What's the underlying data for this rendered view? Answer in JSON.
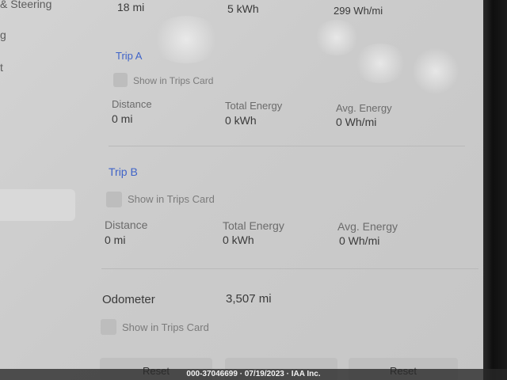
{
  "sidebar": {
    "items": [
      {
        "label": "& Steering"
      },
      {
        "label": "g"
      },
      {
        "label": "t"
      }
    ]
  },
  "top_partial": {
    "distance_value": "18 mi",
    "energy_value": "5 kWh",
    "avg_value": "299 Wh/mi"
  },
  "trip_a": {
    "title": "Trip A",
    "checkbox_label": "Show in Trips Card",
    "distance_label": "Distance",
    "distance_value": "0 mi",
    "energy_label": "Total Energy",
    "energy_value": "0 kWh",
    "avg_label": "Avg. Energy",
    "avg_value": "0 Wh/mi"
  },
  "trip_b": {
    "title": "Trip B",
    "checkbox_label": "Show in Trips Card",
    "distance_label": "Distance",
    "distance_value": "0 mi",
    "energy_label": "Total Energy",
    "energy_value": "0 kWh",
    "avg_label": "Avg. Energy",
    "avg_value": "0 Wh/mi"
  },
  "odometer": {
    "label": "Odometer",
    "value": "3,507 mi",
    "checkbox_label": "Show in Trips Card"
  },
  "buttons": {
    "reset_a": "Reset",
    "reset_c": "Reset"
  },
  "watermark": "000-37046699 · 07/19/2023 · IAA Inc."
}
